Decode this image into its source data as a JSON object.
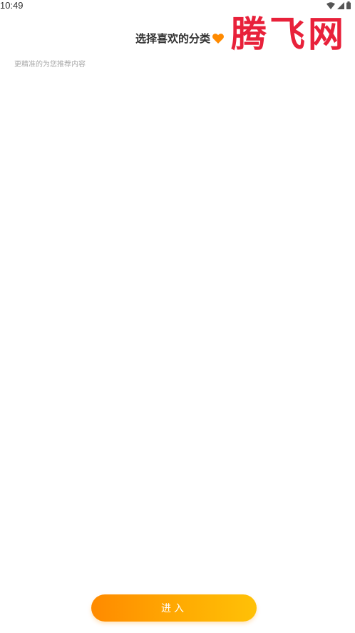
{
  "status_bar": {
    "time": "10:49",
    "icons": [
      "wifi-icon",
      "signal-icon",
      "battery-icon"
    ]
  },
  "header": {
    "title": "选择喜欢的分类",
    "title_icon": "heart-icon",
    "heart_color": "#ff8a00"
  },
  "watermark": {
    "text": "腾飞网",
    "color": "#e8213a"
  },
  "subtitle": "更精准的为您推荐内容",
  "enter_button": {
    "label": "进入",
    "gradient": [
      "#ff8a00",
      "#ffc107"
    ]
  }
}
